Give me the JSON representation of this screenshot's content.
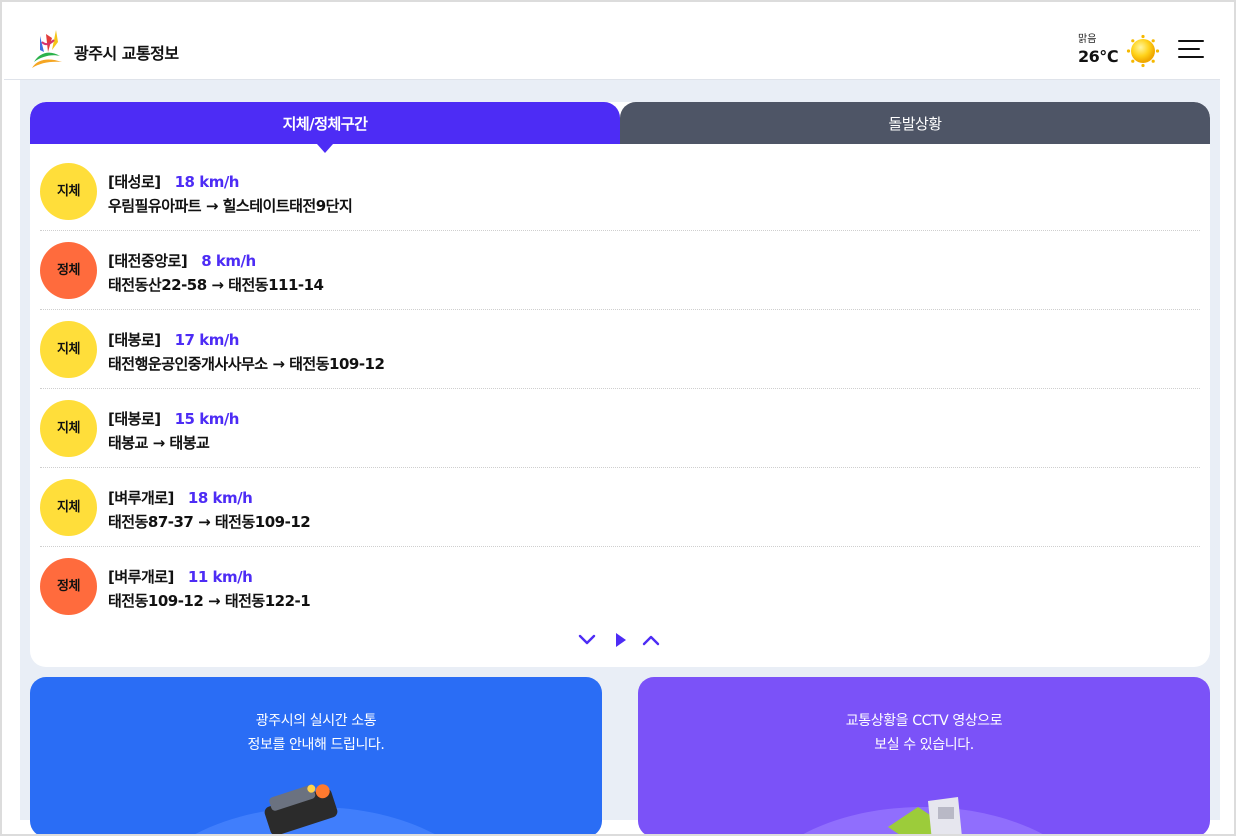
{
  "header": {
    "brand": "광주시 교통정보",
    "weather": {
      "description": "맑음",
      "temperature": "26℃",
      "icon": "sun-icon"
    },
    "menu_icon": "hamburger-menu-icon"
  },
  "tabs": [
    {
      "label": "지체/정체구간",
      "active": true
    },
    {
      "label": "돌발상황",
      "active": false
    }
  ],
  "traffic_list": [
    {
      "status": "지체",
      "road": "[태성로]",
      "speed": "18 km/h",
      "route": "우림필유아파트 → 힐스테이트태전9단지",
      "color": "#ffde3a"
    },
    {
      "status": "정체",
      "road": "[태전중앙로]",
      "speed": "8 km/h",
      "route": "태전동산22-58 → 태전동111-14",
      "color": "#ff6b3d"
    },
    {
      "status": "지체",
      "road": "[태봉로]",
      "speed": "17 km/h",
      "route": "태전행운공인중개사사무소 → 태전동109-12",
      "color": "#ffde3a"
    },
    {
      "status": "지체",
      "road": "[태봉로]",
      "speed": "15 km/h",
      "route": "태봉교 → 태봉교",
      "color": "#ffde3a"
    },
    {
      "status": "지체",
      "road": "[벼루개로]",
      "speed": "18 km/h",
      "route": "태전동87-37 → 태전동109-12",
      "color": "#ffde3a"
    },
    {
      "status": "정체",
      "road": "[벼루개로]",
      "speed": "11 km/h",
      "route": "태전동109-12 → 태전동122-1",
      "color": "#ff6b3d"
    }
  ],
  "pager": {
    "icons": [
      "chevron-down-icon",
      "play-icon",
      "chevron-up-icon"
    ]
  },
  "cards": [
    {
      "line1": "광주시의 실시간 소통",
      "line2": "정보를 안내해 드립니다.",
      "color": "#2a6df5"
    },
    {
      "line1": "교통상황을 CCTV 영상으로",
      "line2": "보실 수 있습니다.",
      "color": "#7b52f8"
    }
  ],
  "colors": {
    "accent": "#4d2cf5",
    "tab_inactive": "#4e5566",
    "delay": "#ffde3a",
    "congestion": "#ff6b3d",
    "background": "#e9eef6"
  }
}
